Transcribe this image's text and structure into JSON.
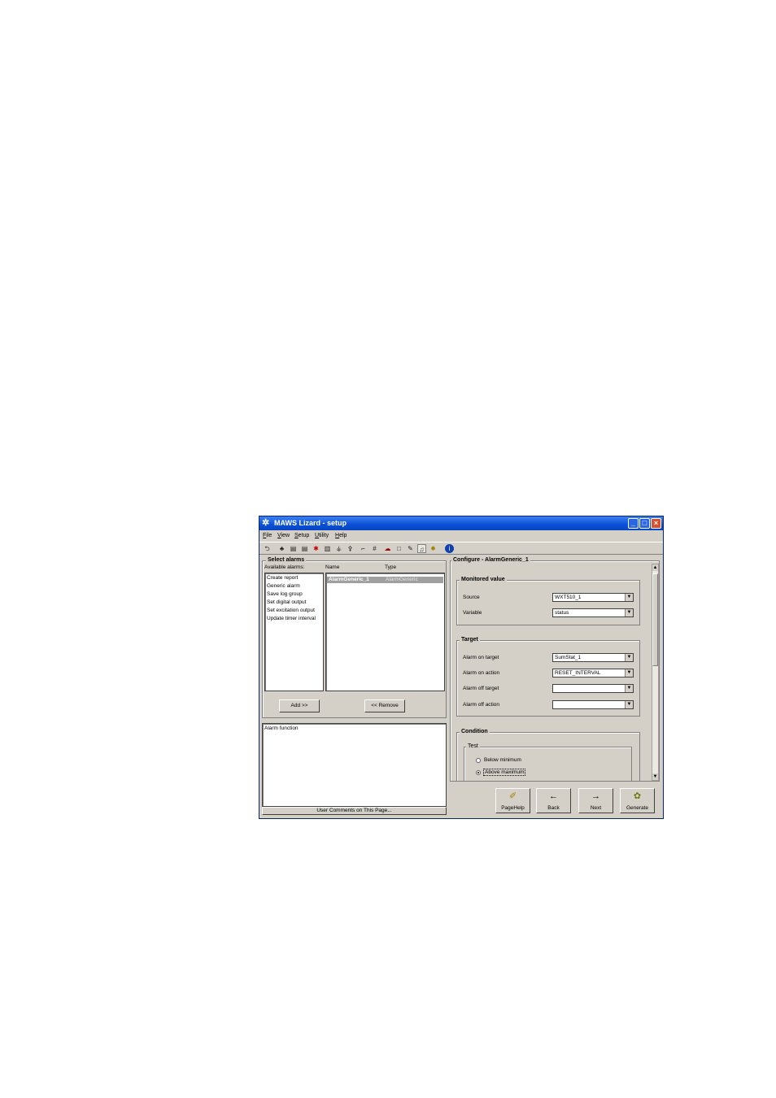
{
  "window": {
    "title": "MAWS Lizard - setup",
    "minimize_glyph": "_",
    "maximize_glyph": "□",
    "close_glyph": "×"
  },
  "menu": [
    "File",
    "View",
    "Setup",
    "Utility",
    "Help"
  ],
  "toolbar": {
    "icons": [
      "undo-icon",
      "network-icon",
      "log-icon",
      "report-icon",
      "sensor-icon",
      "panel-icon",
      "station-icon",
      "weather-icon",
      "graph-icon",
      "grid-icon",
      "cloud-icon",
      "box-icon",
      "pen-icon",
      "alarm-icon",
      "gear-icon",
      "info-icon"
    ]
  },
  "select_alarms": {
    "group_label": "Select alarms",
    "available_label": "Available alarms:",
    "available": [
      "Create report",
      "Generic alarm",
      "Save log group",
      "Set digital output",
      "Set excitation output",
      "Update timer interval"
    ],
    "columns": [
      "Name",
      "Type"
    ],
    "selected_rows": [
      {
        "name": "AlarmGeneric_1",
        "type": "AlarmGeneric"
      }
    ],
    "add_button": "Add >>",
    "remove_button": "<< Remove",
    "description": "Alarm function",
    "comments_button": "User Comments on This Page..."
  },
  "configure": {
    "title": "Configure - AlarmGeneric_1",
    "monitored": {
      "label": "Monitored value",
      "source_label": "Source",
      "source_value": "WXT510_1",
      "variable_label": "Variable",
      "variable_value": "status"
    },
    "target": {
      "label": "Target",
      "on_target_label": "Alarm on target",
      "on_target_value": "SumStat_1",
      "on_action_label": "Alarm on action",
      "on_action_value": "RESET_INTERVAL",
      "off_target_label": "Alarm off target",
      "off_target_value": "",
      "off_action_label": "Alarm off action",
      "off_action_value": ""
    },
    "condition": {
      "label": "Condition",
      "test_label": "Test",
      "below_label": "Below minimum",
      "above_label": "Above maximum",
      "selected": "Above maximum"
    }
  },
  "nav_buttons": {
    "pagehelp": "PageHelp",
    "back": "Back",
    "next": "Next",
    "generate": "Generate"
  }
}
